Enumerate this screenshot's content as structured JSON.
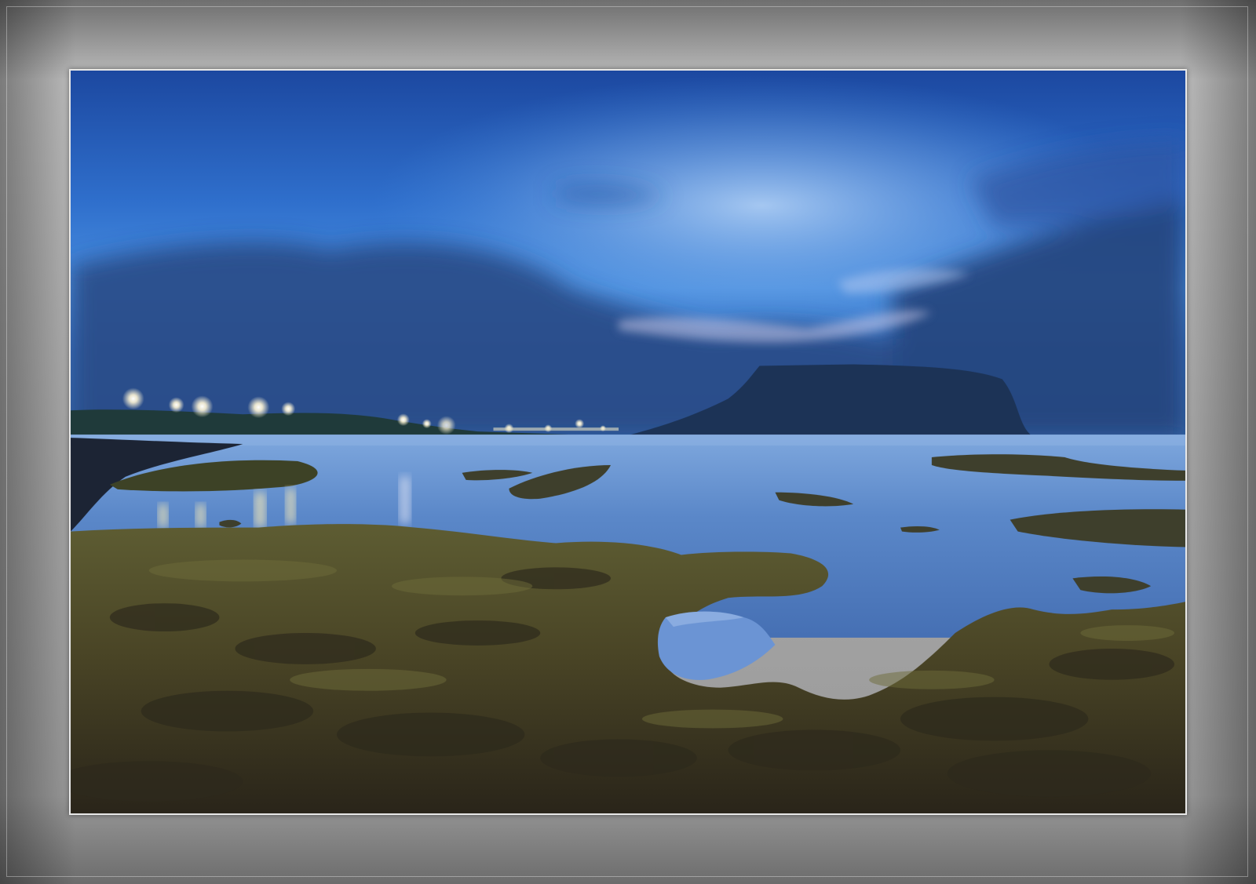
{
  "scene": {
    "subject": "coastal-night-landscape",
    "colors": {
      "frame_gray": "#a9a9a9",
      "photo_border": "#e8e8e8",
      "sky_top": "#1f4fa8",
      "sky_mid": "#3f86dc",
      "sky_glow": "#9ec4f2",
      "cloud_dark": "#22407a",
      "water": "#5a86c8",
      "headland": "#1c3356",
      "rock_moss": "#5b5a2c",
      "rock_dark": "#2e2a1e",
      "light_glow": "#fff6d6"
    }
  }
}
